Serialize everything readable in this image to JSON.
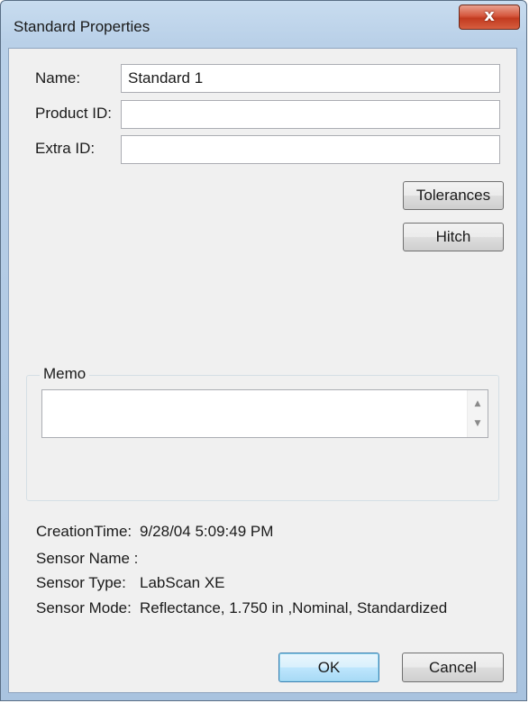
{
  "window": {
    "title": "Standard Properties",
    "close_label": "x"
  },
  "form": {
    "name_label": "Name:",
    "name_value": "Standard 1",
    "product_id_label": "Product ID:",
    "product_id_value": "",
    "extra_id_label": "Extra ID:",
    "extra_id_value": ""
  },
  "buttons": {
    "tolerances": "Tolerances",
    "hitch": "Hitch",
    "ok": "OK",
    "cancel": "Cancel"
  },
  "memo": {
    "label": "Memo",
    "value": "",
    "scroll_up_icon": "▲",
    "scroll_down_icon": "▼"
  },
  "info": {
    "creation_time_label": "CreationTime:",
    "creation_time_value": "9/28/04 5:09:49 PM",
    "sensor_name_label": "Sensor Name :",
    "sensor_name_value": "",
    "sensor_type_label": "Sensor Type:",
    "sensor_type_value": "LabScan XE",
    "sensor_mode_label": "Sensor Mode:",
    "sensor_mode_value": "Reflectance, 1.750 in ,Nominal, Standardized"
  },
  "colors": {
    "titlebar": "#b9d0e8",
    "dialog_bg": "#f0f0f0",
    "close_button": "#c23a1f",
    "default_button": "#3c7fb1"
  }
}
